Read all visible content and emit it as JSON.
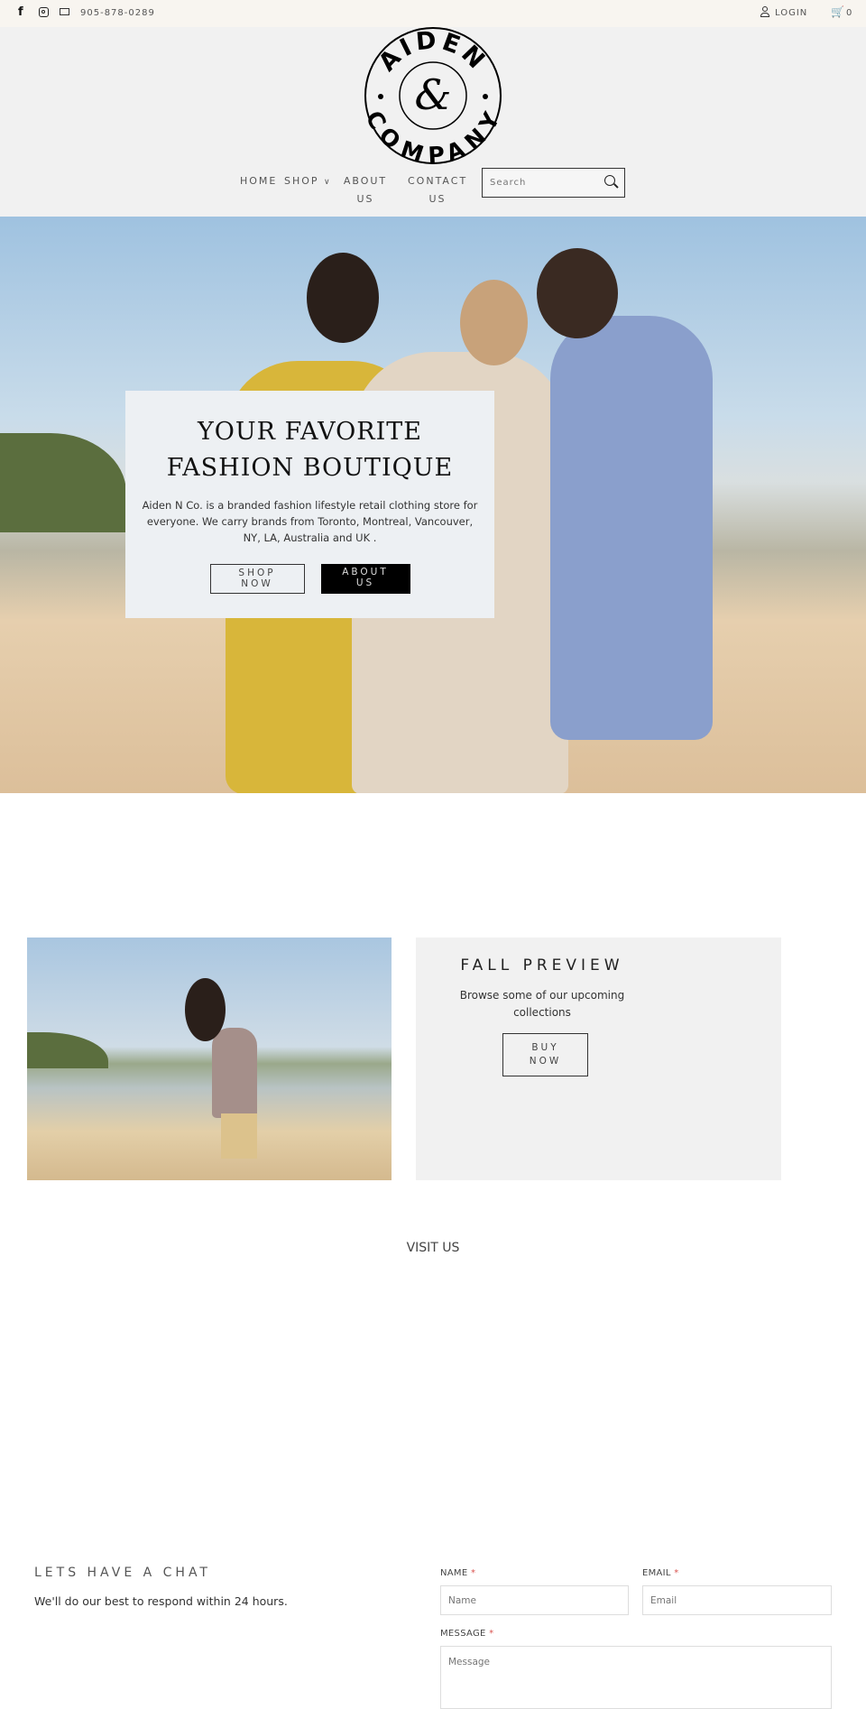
{
  "topbar": {
    "phone": "905-878-0289",
    "login": "LOGIN",
    "cart_count": "0",
    "icons": [
      "facebook-icon",
      "instagram-icon",
      "mail-icon",
      "user-icon",
      "cart-icon"
    ]
  },
  "logo": {
    "top_text": "AIDEN",
    "bottom_text": "COMPANY",
    "monogram": "&"
  },
  "nav": {
    "items": [
      {
        "label": "HOME"
      },
      {
        "label": "SHOP"
      },
      {
        "label": "ABOUT US"
      },
      {
        "label": "CONTACT US"
      }
    ],
    "search_placeholder": "Search"
  },
  "hero": {
    "title_line1": "YOUR FAVORITE",
    "title_line2": "FASHION BOUTIQUE",
    "description": "Aiden N Co. is a branded fashion lifestyle retail clothing store for everyone. We carry brands from Toronto, Montreal, Vancouver, NY, LA, Australia and UK .",
    "shop_now": "SHOP NOW",
    "about_us": "ABOUT US"
  },
  "fall": {
    "title": "FALL PREVIEW",
    "text": "Browse some of our upcoming collections",
    "button": "BUY NOW"
  },
  "visit": {
    "title": "VISIT US"
  },
  "chat": {
    "title": "LETS HAVE A CHAT",
    "text": "We'll do our best to respond within 24 hours.",
    "name_label": "NAME",
    "email_label": "EMAIL",
    "message_label": "MESSAGE",
    "required": "*",
    "name_placeholder": "Name",
    "email_placeholder": "Email",
    "message_placeholder": "Message"
  },
  "colors": {
    "topbar_bg": "#f8f5f0",
    "header_bg": "#f1f1f1",
    "overlay_bg": "#edf0f3",
    "button_dark": "#000000",
    "required": "#d9534f"
  }
}
